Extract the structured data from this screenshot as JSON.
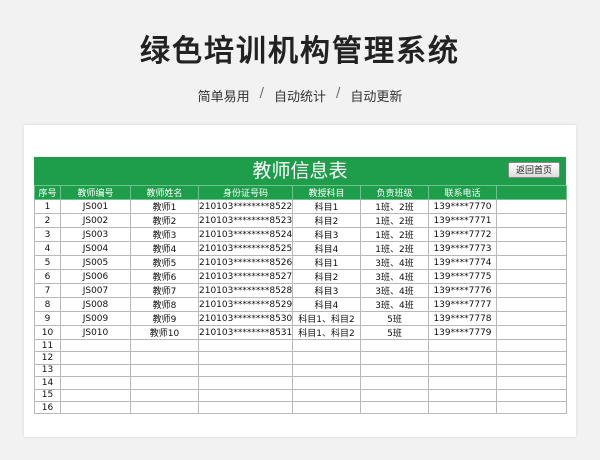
{
  "page": {
    "title": "绿色培训机构管理系统",
    "subtitle_parts": [
      "简单易用",
      "自动统计",
      "自动更新"
    ],
    "separator": "/"
  },
  "sheet": {
    "title": "教师信息表",
    "back_button": "返回首页",
    "columns": [
      "序号",
      "教师编号",
      "教师姓名",
      "身份证号码",
      "教授科目",
      "负责班级",
      "联系电话",
      ""
    ],
    "rows": [
      [
        "1",
        "JS001",
        "教师1",
        "210103********8522",
        "科目1",
        "1班、2班",
        "139****7770",
        ""
      ],
      [
        "2",
        "JS002",
        "教师2",
        "210103********8523",
        "科目2",
        "1班、2班",
        "139****7771",
        ""
      ],
      [
        "3",
        "JS003",
        "教师3",
        "210103********8524",
        "科目3",
        "1班、2班",
        "139****7772",
        ""
      ],
      [
        "4",
        "JS004",
        "教师4",
        "210103********8525",
        "科目4",
        "1班、2班",
        "139****7773",
        ""
      ],
      [
        "5",
        "JS005",
        "教师5",
        "210103********8526",
        "科目1",
        "3班、4班",
        "139****7774",
        ""
      ],
      [
        "6",
        "JS006",
        "教师6",
        "210103********8527",
        "科目2",
        "3班、4班",
        "139****7775",
        ""
      ],
      [
        "7",
        "JS007",
        "教师7",
        "210103********8528",
        "科目3",
        "3班、4班",
        "139****7776",
        ""
      ],
      [
        "8",
        "JS008",
        "教师8",
        "210103********8529",
        "科目4",
        "3班、4班",
        "139****7777",
        ""
      ],
      [
        "9",
        "JS009",
        "教师9",
        "210103********8530",
        "科目1、科目2",
        "5班",
        "139****7778",
        ""
      ],
      [
        "10",
        "JS010",
        "教师10",
        "210103********8531",
        "科目1、科目2",
        "5班",
        "139****7779",
        ""
      ],
      [
        "11",
        "",
        "",
        "",
        "",
        "",
        "",
        ""
      ],
      [
        "12",
        "",
        "",
        "",
        "",
        "",
        "",
        ""
      ],
      [
        "13",
        "",
        "",
        "",
        "",
        "",
        "",
        ""
      ],
      [
        "14",
        "",
        "",
        "",
        "",
        "",
        "",
        ""
      ],
      [
        "15",
        "",
        "",
        "",
        "",
        "",
        "",
        ""
      ],
      [
        "16",
        "",
        "",
        "",
        "",
        "",
        "",
        ""
      ]
    ]
  },
  "colors": {
    "accent": "#1e9e4a",
    "background": "#f2f2f2"
  }
}
